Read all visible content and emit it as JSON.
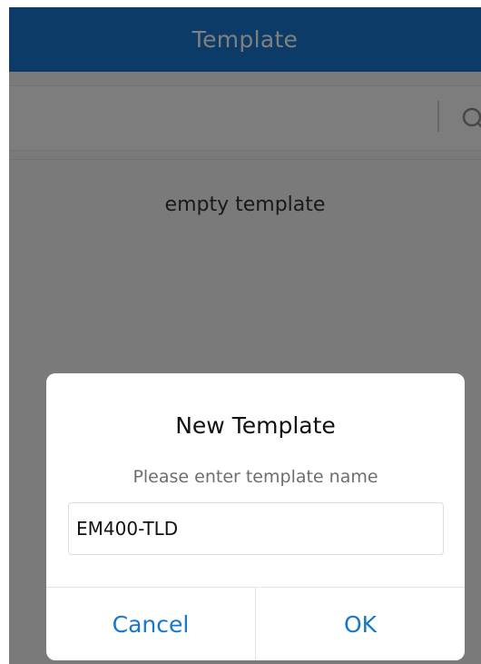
{
  "header": {
    "title": "Template"
  },
  "search": {
    "icon": "search-icon"
  },
  "list": {
    "empty_text": "empty template"
  },
  "dialog": {
    "title": "New Template",
    "placeholder": "Please enter template name",
    "input_value": "EM400-TLD",
    "cancel_label": "Cancel",
    "ok_label": "OK"
  },
  "colors": {
    "accent": "#1677cc",
    "overlay": "rgba(0,0,0,0.5)"
  }
}
